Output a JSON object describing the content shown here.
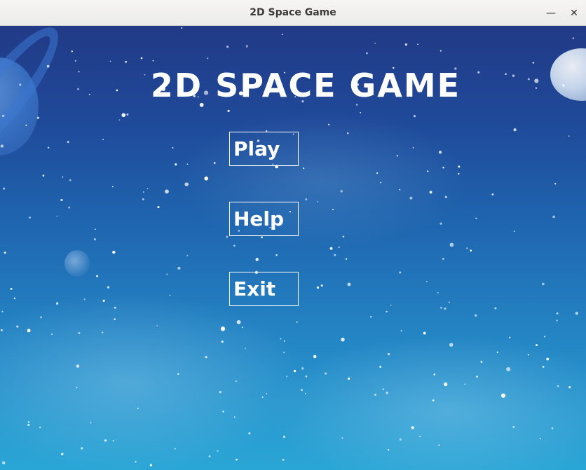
{
  "window": {
    "title": "2D Space Game",
    "minimize_glyph": "—",
    "close_glyph": "✕"
  },
  "game": {
    "title": "2D SPACE GAME"
  },
  "menu": {
    "items": [
      {
        "label": "Play"
      },
      {
        "label": "Help"
      },
      {
        "label": "Exit"
      }
    ]
  },
  "icons": {
    "minimize": "minimize-icon",
    "close": "close-icon"
  },
  "colors": {
    "sky_top": "#213a86",
    "sky_bottom": "#2aa6d6",
    "text": "#ffffff"
  }
}
